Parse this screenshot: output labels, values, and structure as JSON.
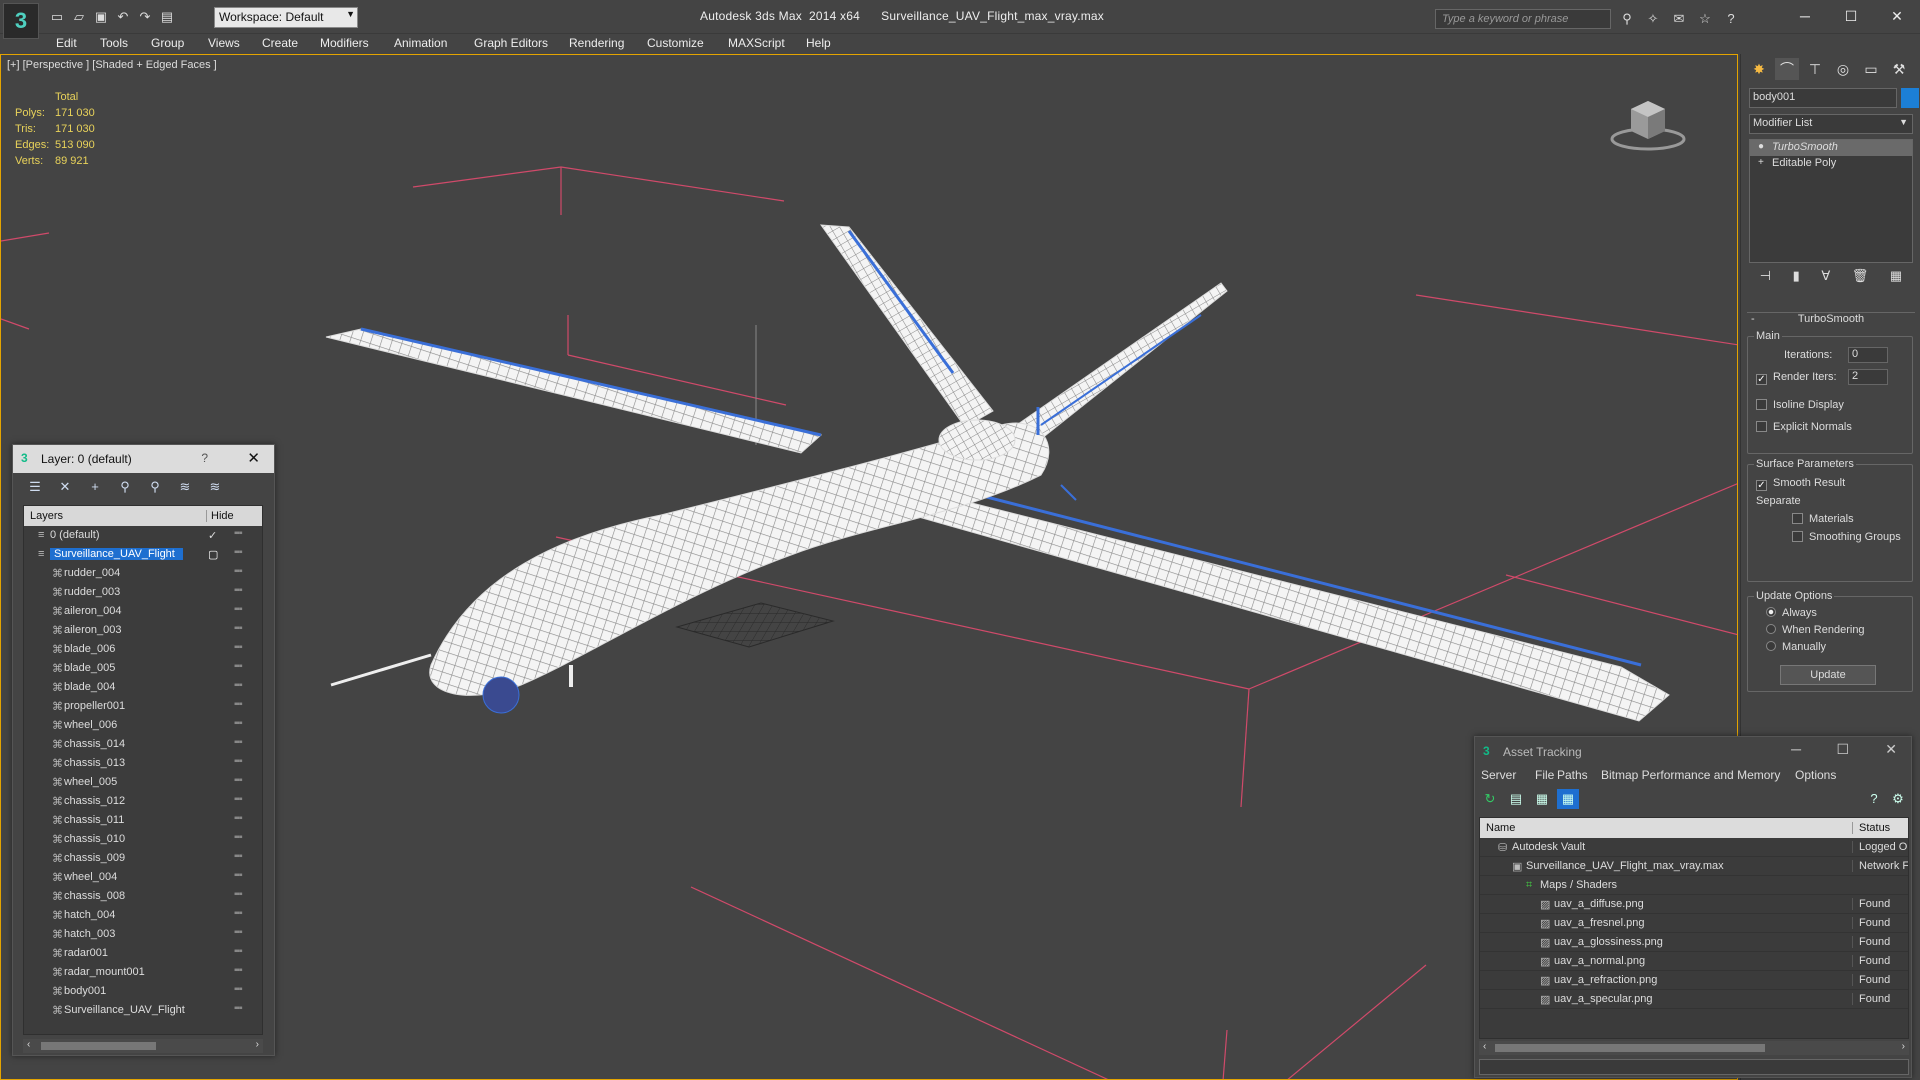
{
  "app": {
    "title": "Autodesk 3ds Max  2014 x64      Surveillance_UAV_Flight_max_vray.max",
    "workspace": "Workspace: Default",
    "search_placeholder": "Type a keyword or phrase"
  },
  "menu": [
    "Edit",
    "Tools",
    "Group",
    "Views",
    "Create",
    "Modifiers",
    "Animation",
    "Graph Editors",
    "Rendering",
    "Customize",
    "MAXScript",
    "Help"
  ],
  "viewport": {
    "label": "[+] [Perspective ] [Shaded + Edged Faces ]",
    "stats": {
      "header": "Total",
      "polys_label": "Polys:",
      "polys": "171 030",
      "tris_label": "Tris:",
      "tris": "171 030",
      "edges_label": "Edges:",
      "edges": "513 090",
      "verts_label": "Verts:",
      "verts": "89 921"
    }
  },
  "layer_panel": {
    "title": "Layer: 0 (default)",
    "help": "?",
    "col_layers": "Layers",
    "col_hide": "Hide",
    "rows": [
      {
        "name": "0 (default)",
        "level": 0
      },
      {
        "name": "Surveillance_UAV_Flight",
        "level": 0,
        "selected": true
      },
      {
        "name": "rudder_004",
        "level": 1
      },
      {
        "name": "rudder_003",
        "level": 1
      },
      {
        "name": "aileron_004",
        "level": 1
      },
      {
        "name": "aileron_003",
        "level": 1
      },
      {
        "name": "blade_006",
        "level": 1
      },
      {
        "name": "blade_005",
        "level": 1
      },
      {
        "name": "blade_004",
        "level": 1
      },
      {
        "name": "propeller001",
        "level": 1
      },
      {
        "name": "wheel_006",
        "level": 1
      },
      {
        "name": "chassis_014",
        "level": 1
      },
      {
        "name": "chassis_013",
        "level": 1
      },
      {
        "name": "wheel_005",
        "level": 1
      },
      {
        "name": "chassis_012",
        "level": 1
      },
      {
        "name": "chassis_011",
        "level": 1
      },
      {
        "name": "chassis_010",
        "level": 1
      },
      {
        "name": "chassis_009",
        "level": 1
      },
      {
        "name": "wheel_004",
        "level": 1
      },
      {
        "name": "chassis_008",
        "level": 1
      },
      {
        "name": "hatch_004",
        "level": 1
      },
      {
        "name": "hatch_003",
        "level": 1
      },
      {
        "name": "radar001",
        "level": 1
      },
      {
        "name": "radar_mount001",
        "level": 1
      },
      {
        "name": "body001",
        "level": 1
      },
      {
        "name": "Surveillance_UAV_Flight",
        "level": 1
      }
    ]
  },
  "command_panel": {
    "object_name": "body001",
    "object_color": "#1c7fd6",
    "modifier_list": "Modifier List",
    "stack": [
      "TurboSmooth",
      "Editable Poly"
    ],
    "turbosmooth": {
      "header": "TurboSmooth",
      "main_label": "Main",
      "iterations_label": "Iterations:",
      "iterations": "0",
      "render_iters_label": "Render Iters:",
      "render_iters": "2",
      "render_iters_checked": true,
      "isoline_label": "Isoline Display",
      "explicit_normals_label": "Explicit Normals",
      "surface_label": "Surface Parameters",
      "smooth_result_label": "Smooth Result",
      "separate_label": "Separate",
      "materials_label": "Materials",
      "smoothing_groups_label": "Smoothing Groups",
      "update_options_label": "Update Options",
      "always_label": "Always",
      "when_rendering_label": "When Rendering",
      "manually_label": "Manually",
      "update_button": "Update"
    }
  },
  "asset_tracking": {
    "title": "Asset Tracking",
    "menu": [
      "Server",
      "File",
      "Paths",
      "Bitmap Performance and Memory",
      "Options"
    ],
    "col_name": "Name",
    "col_status": "Status",
    "rows": [
      {
        "name": "Autodesk Vault",
        "status": "Logged O",
        "indent": 1
      },
      {
        "name": "Surveillance_UAV_Flight_max_vray.max",
        "status": "Network F",
        "indent": 2
      },
      {
        "name": "Maps / Shaders",
        "status": "",
        "indent": 3
      },
      {
        "name": "uav_a_diffuse.png",
        "status": "Found",
        "indent": 4
      },
      {
        "name": "uav_a_fresnel.png",
        "status": "Found",
        "indent": 4
      },
      {
        "name": "uav_a_glossiness.png",
        "status": "Found",
        "indent": 4
      },
      {
        "name": "uav_a_normal.png",
        "status": "Found",
        "indent": 4
      },
      {
        "name": "uav_a_refraction.png",
        "status": "Found",
        "indent": 4
      },
      {
        "name": "uav_a_specular.png",
        "status": "Found",
        "indent": 4
      }
    ]
  },
  "colors": {
    "selection": "#1e6fd0",
    "viewport_border": "#e4a400",
    "stats_text": "#e8d25a",
    "wireframe": "#ffffff",
    "wire_accent": "#3a6fd8",
    "grid_lines": "#d04a6a"
  },
  "icons": {
    "app_logo": "3ds-max-logo-icon",
    "viewcube": "viewcube-icon"
  }
}
